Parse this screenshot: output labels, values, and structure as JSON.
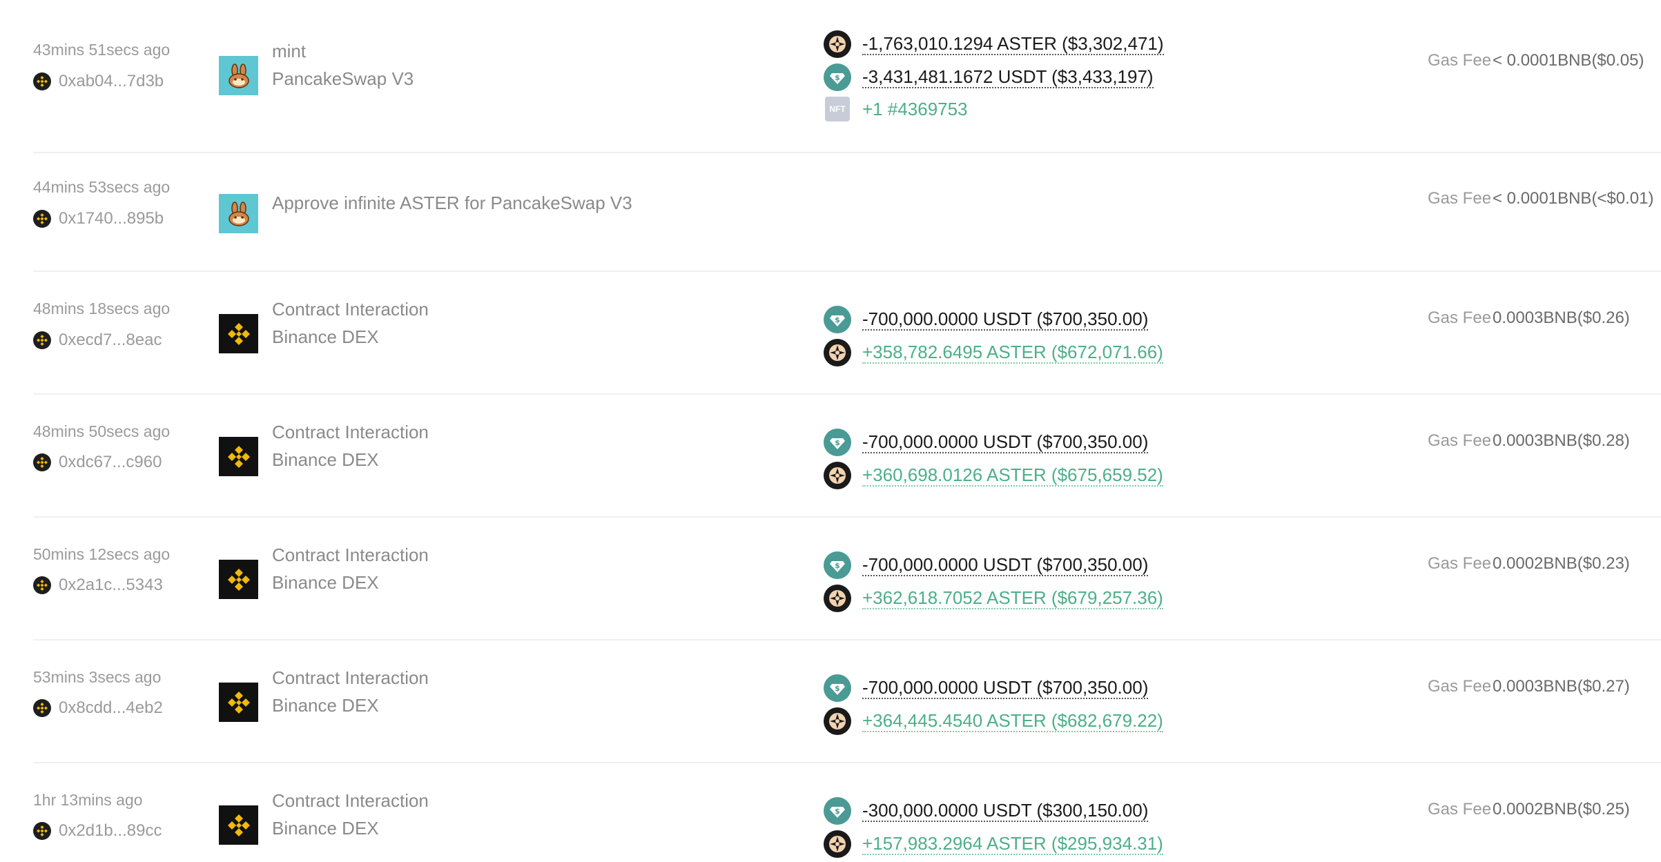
{
  "gas_label": "Gas Fee",
  "colors": {
    "positive": "#4caf8a",
    "negative": "#1a1a1a",
    "muted": "#9a9a9a",
    "usdt": "#4a9a95",
    "pancake": "#5fc6d4"
  },
  "rows": [
    {
      "time": "43mins 51secs ago",
      "hash": "0xab04...7d3b",
      "app_icon": "pancakeswap-bunny-icon",
      "action": "mint",
      "app": "PancakeSwap V3",
      "changes": [
        {
          "icon": "aster-token-icon",
          "text": "-1,763,010.1294 ASTER ($3,302,471)",
          "sign": "neg"
        },
        {
          "icon": "usdt-token-icon",
          "text": "-3,431,481.1672 USDT ($3,433,197)",
          "sign": "neg"
        },
        {
          "icon": "nft-icon",
          "icon_text": "NFT",
          "text": "+1 #4369753",
          "sign": "nft"
        }
      ],
      "gas": "< 0.0001BNB($0.05)"
    },
    {
      "time": "44mins 53secs ago",
      "hash": "0x1740...895b",
      "app_icon": "pancakeswap-bunny-icon",
      "action": "Approve infinite ASTER for PancakeSwap V3",
      "app": "",
      "changes": [],
      "gas": "< 0.0001BNB(<$0.01)"
    },
    {
      "time": "48mins 18secs ago",
      "hash": "0xecd7...8eac",
      "app_icon": "binance-icon",
      "action": "Contract Interaction",
      "app": "Binance DEX",
      "changes": [
        {
          "icon": "usdt-token-icon",
          "text": "-700,000.0000 USDT ($700,350.00)",
          "sign": "neg"
        },
        {
          "icon": "aster-token-icon",
          "text": "+358,782.6495 ASTER ($672,071.66)",
          "sign": "pos"
        }
      ],
      "gas": "0.0003BNB($0.26)"
    },
    {
      "time": "48mins 50secs ago",
      "hash": "0xdc67...c960",
      "app_icon": "binance-icon",
      "action": "Contract Interaction",
      "app": "Binance DEX",
      "changes": [
        {
          "icon": "usdt-token-icon",
          "text": "-700,000.0000 USDT ($700,350.00)",
          "sign": "neg"
        },
        {
          "icon": "aster-token-icon",
          "text": "+360,698.0126 ASTER ($675,659.52)",
          "sign": "pos"
        }
      ],
      "gas": "0.0003BNB($0.28)"
    },
    {
      "time": "50mins 12secs ago",
      "hash": "0x2a1c...5343",
      "app_icon": "binance-icon",
      "action": "Contract Interaction",
      "app": "Binance DEX",
      "changes": [
        {
          "icon": "usdt-token-icon",
          "text": "-700,000.0000 USDT ($700,350.00)",
          "sign": "neg"
        },
        {
          "icon": "aster-token-icon",
          "text": "+362,618.7052 ASTER ($679,257.36)",
          "sign": "pos"
        }
      ],
      "gas": "0.0002BNB($0.23)"
    },
    {
      "time": "53mins 3secs ago",
      "hash": "0x8cdd...4eb2",
      "app_icon": "binance-icon",
      "action": "Contract Interaction",
      "app": "Binance DEX",
      "changes": [
        {
          "icon": "usdt-token-icon",
          "text": "-700,000.0000 USDT ($700,350.00)",
          "sign": "neg"
        },
        {
          "icon": "aster-token-icon",
          "text": "+364,445.4540 ASTER ($682,679.22)",
          "sign": "pos"
        }
      ],
      "gas": "0.0003BNB($0.27)"
    },
    {
      "time": "1hr 13mins ago",
      "hash": "0x2d1b...89cc",
      "app_icon": "binance-icon",
      "action": "Contract Interaction",
      "app": "Binance DEX",
      "changes": [
        {
          "icon": "usdt-token-icon",
          "text": "-300,000.0000 USDT ($300,150.00)",
          "sign": "neg"
        },
        {
          "icon": "aster-token-icon",
          "text": "+157,983.2964 ASTER ($295,934.31)",
          "sign": "pos"
        }
      ],
      "gas": "0.0002BNB($0.25)"
    }
  ]
}
